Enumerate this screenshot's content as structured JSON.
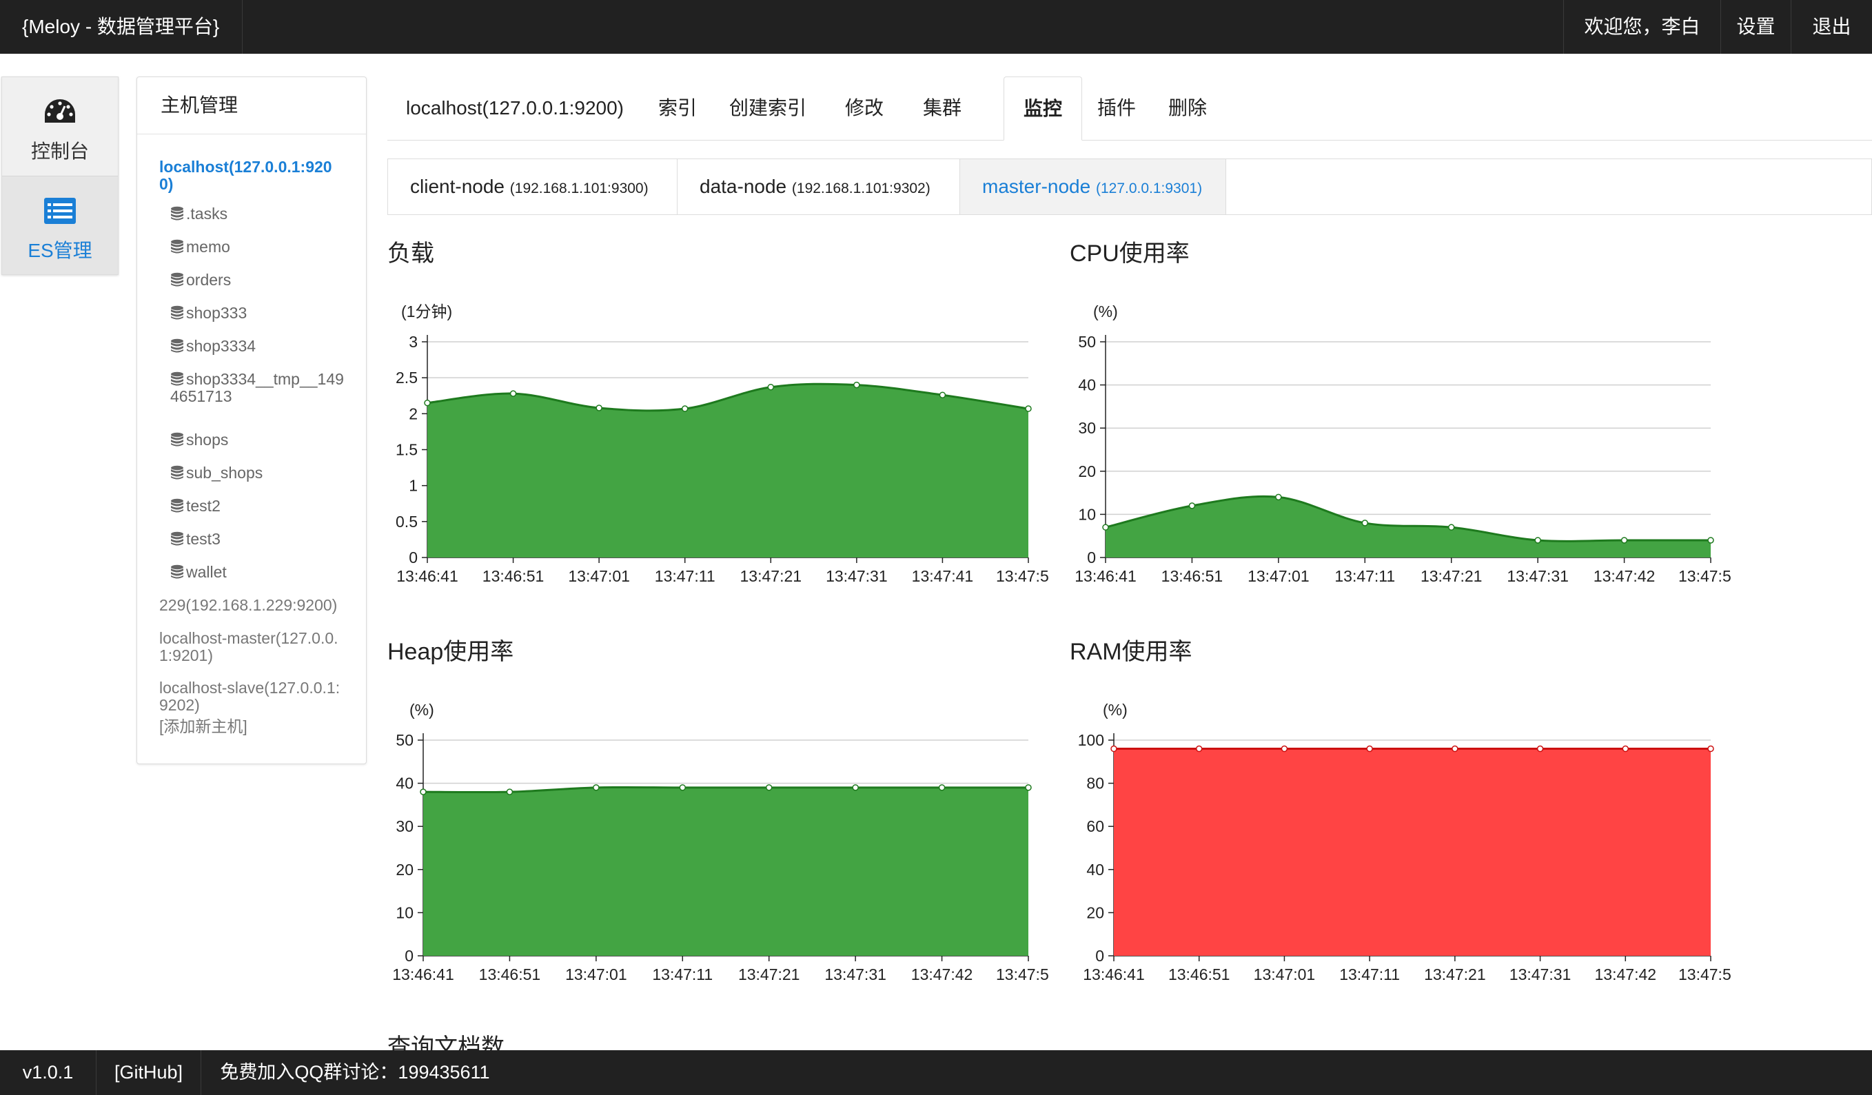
{
  "header": {
    "brand": "{Meloy - 数据管理平台}",
    "welcome": "欢迎您，李白",
    "settings": "设置",
    "logout": "退出"
  },
  "modules": [
    {
      "label": "控制台",
      "icon": "dashboard-icon"
    },
    {
      "label": "ES管理",
      "icon": "list-icon"
    }
  ],
  "host_panel": {
    "title": "主机管理",
    "active_host": "localhost(127.0.0.1:9200)",
    "indices": [
      ".tasks",
      "memo",
      "orders",
      "shop333",
      "shop3334",
      "shop3334__tmp__1494651713",
      "shops",
      "sub_shops",
      "test2",
      "test3",
      "wallet"
    ],
    "hosts": [
      "229(192.168.1.229:9200)",
      "localhost-master(127.0.0.1:9201)",
      "localhost-slave(127.0.0.1:9202)"
    ],
    "add_host": "[添加新主机]"
  },
  "tabs": [
    "localhost(127.0.0.1:9200)",
    "索引",
    "创建索引",
    "修改",
    "集群",
    "监控",
    "插件",
    "删除"
  ],
  "active_tab": "监控",
  "nodes": [
    {
      "name": "client-node",
      "addr": "(192.168.1.101:9300)"
    },
    {
      "name": "data-node",
      "addr": "(192.168.1.101:9302)"
    },
    {
      "name": "master-node",
      "addr": "(127.0.0.1:9301)"
    }
  ],
  "active_node": "master-node",
  "chart_data": [
    {
      "type": "area",
      "title": "负载",
      "ylabel": "(1分钟)",
      "ylim": [
        0,
        3
      ],
      "yticks": [
        "0",
        "0.5",
        "1",
        "1.5",
        "2",
        "2.5",
        "3"
      ],
      "x": [
        "13:46:41",
        "13:46:51",
        "13:47:01",
        "13:47:11",
        "13:47:21",
        "13:47:31",
        "13:47:41",
        "13:47:5"
      ],
      "values": [
        2.15,
        2.28,
        2.08,
        2.07,
        2.37,
        2.4,
        2.26,
        2.07
      ],
      "color": "#43a443",
      "line_color": "#1e7a1e"
    },
    {
      "type": "area",
      "title": "CPU使用率",
      "ylabel": "(%)",
      "ylim": [
        0,
        50
      ],
      "yticks": [
        "0",
        "10",
        "20",
        "30",
        "40",
        "50"
      ],
      "x": [
        "13:46:41",
        "13:46:51",
        "13:47:01",
        "13:47:11",
        "13:47:21",
        "13:47:31",
        "13:47:42",
        "13:47:5"
      ],
      "values": [
        7,
        12,
        14,
        8,
        7,
        4,
        4,
        4
      ],
      "color": "#43a443",
      "line_color": "#1e7a1e"
    },
    {
      "type": "area",
      "title": "Heap使用率",
      "ylabel": "(%)",
      "ylim": [
        0,
        50
      ],
      "yticks": [
        "0",
        "10",
        "20",
        "30",
        "40",
        "50"
      ],
      "x": [
        "13:46:41",
        "13:46:51",
        "13:47:01",
        "13:47:11",
        "13:47:21",
        "13:47:31",
        "13:47:42",
        "13:47:5"
      ],
      "values": [
        38,
        38,
        39,
        39,
        39,
        39,
        39,
        39
      ],
      "color": "#43a443",
      "line_color": "#1e7a1e"
    },
    {
      "type": "area",
      "title": "RAM使用率",
      "ylabel": "(%)",
      "ylim": [
        0,
        100
      ],
      "yticks": [
        "0",
        "20",
        "40",
        "60",
        "80",
        "100"
      ],
      "x": [
        "13:46:41",
        "13:46:51",
        "13:47:01",
        "13:47:11",
        "13:47:21",
        "13:47:31",
        "13:47:42",
        "13:47:5"
      ],
      "values": [
        96,
        96,
        96,
        96,
        96,
        96,
        96,
        96
      ],
      "color": "#ff4444",
      "line_color": "#cc1111"
    }
  ],
  "next_section_title": "查询文档数",
  "footer": {
    "version": "v1.0.1",
    "github": "[GitHub]",
    "qq": "免费加入QQ群讨论：199435611"
  }
}
